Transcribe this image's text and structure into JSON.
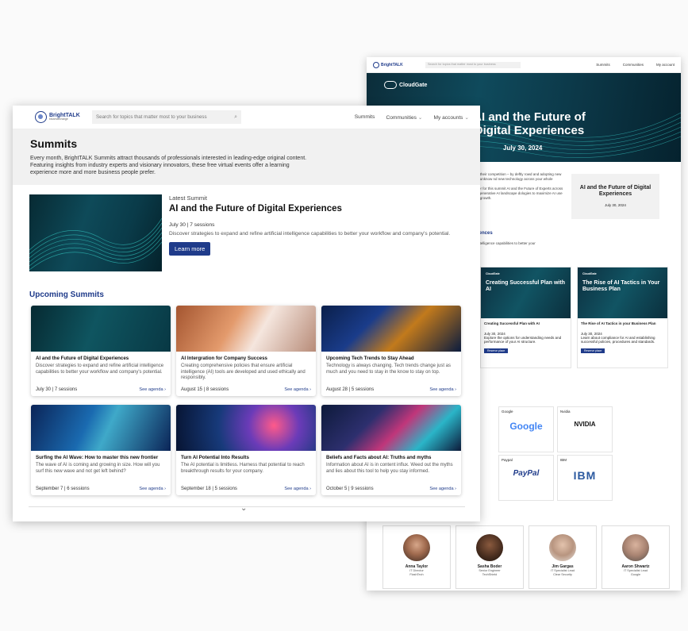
{
  "back": {
    "nav": {
      "brand": "BrightTALK",
      "search_placeholder": "Search for topics that matter most to your business",
      "links": [
        "Summits",
        "Communities",
        "My account"
      ]
    },
    "hero": {
      "brand": "CloudGate",
      "title": "AI and the Future of Digital Experiences",
      "date": "July 30, 2024"
    },
    "intro": [
      "d of their competition – by deftly rowd and adopting new and unknow nd new technology across your whole",
      "gister for this summit AI and the Future of Experts across the generative AI landscape dologies to maximize AI use and growth."
    ],
    "summary_card": {
      "title": "AI and the Future of Digital Experiences",
      "date": "July 30, 2024"
    },
    "experiences_heading": "iences",
    "experiences_text": "ntelligence capabilities to better your",
    "sessions": [
      {
        "brand": "CloudGate",
        "image_title": "Creating Successful Plan with AI",
        "title": "Creating Successful Plan with AI",
        "date": "July 30, 2024",
        "desc": "Explore the options for understanding needs and performance of your AI structure.",
        "button": "Reserve place"
      },
      {
        "brand": "CloudGate",
        "image_title": "The Rise of AI Tactics in Your Business Plan",
        "title": "The Rise of AI Tactics in your Business Plan",
        "date": "July 30, 2024",
        "desc": "Learn about compliance for AI and establishing successful policies, procedures and standards.",
        "button": "Reserve place"
      }
    ],
    "sponsors": [
      {
        "name": "Google",
        "logo": "Google"
      },
      {
        "name": "Nvidia",
        "logo": "NVIDIA"
      },
      {
        "name": "Paypal",
        "logo": "PayPal"
      },
      {
        "name": "IBM",
        "logo": "IBM"
      }
    ],
    "speakers": [
      {
        "name": "Anna Taylor",
        "role": "IT Director",
        "company": "FlashTech"
      },
      {
        "name": "Sasha Boder",
        "role": "Senior Engineer",
        "company": "TechShield"
      },
      {
        "name": "Jim Gargas",
        "role": "IT Specialist Lead",
        "company": "Clear Security"
      },
      {
        "name": "Aaron Shwartz",
        "role": "IT Specialist Lead",
        "company": "Google"
      }
    ]
  },
  "front": {
    "nav": {
      "brand": "BrightTALK",
      "brand_sub": "bikamarcharge",
      "search_placeholder": "Search for topics that matter most to your business",
      "links": {
        "summits": "Summits",
        "communities": "Communities",
        "accounts": "My accounts"
      }
    },
    "header": {
      "title": "Summits",
      "desc": "Every month, BrightTALK Summits attract thousands of professionals interested in leading-edge original content. Featuring insights from industry experts and visionary innovators, these free virtual events offer a learning experience more and more business people prefer."
    },
    "latest": {
      "label": "Latest Summit",
      "title": "AI and the Future of Digital Experiences",
      "meta": "July 30  |  7 sessions",
      "desc": "Discover strategies to expand and refine artificial intelligence capabilities to better your workflow and company's potential.",
      "button": "Learn more"
    },
    "upcoming_heading": "Upcoming Summits",
    "cards": [
      {
        "title": "AI and the Future of Digital Experiences",
        "desc": "Discover strategies to expand and refine artificial intelligence capabilities to better your workflow and company's potential.",
        "meta": "July 30  |  7 sessions",
        "agenda": "See agenda ›"
      },
      {
        "title": "AI Intergration for Company Success",
        "desc": "Creating comprehensive policies that ensure artificial intelligence (AI) tools are developed and used ethically and responsibly.",
        "meta": "August 15  |  8 sessions",
        "agenda": "See agenda ›"
      },
      {
        "title": "Upcoming Tech Trends to Stay Ahead",
        "desc": "Technology is always changing. Tech trends change just as much and you need to stay in the know to stay on top.",
        "meta": "August 28  |  5 sessions",
        "agenda": "See agenda ›"
      },
      {
        "title": "Surfing the AI Wave: How to master this new frontier",
        "desc": "The wave of AI is coming and growing in size. How will you surf this new wave and not get left behind?",
        "meta": "September 7  |  6 sessions",
        "agenda": "See agenda ›"
      },
      {
        "title": "Turn AI Potential Into Results",
        "desc": "The AI potential is limitless. Harness that potential to reach breakthrough results for your company.",
        "meta": "September 18  |  5 sessions",
        "agenda": "See agenda ›"
      },
      {
        "title": "Beliefs and Facts about AI: Truths and myths",
        "desc": "Information about AI is in content influx. Weed out the myths and lies about this tool to help you stay informed.",
        "meta": "October 5  |  9 sessions",
        "agenda": "See agenda ›"
      }
    ],
    "more_icon": "chevron-down-icon"
  }
}
